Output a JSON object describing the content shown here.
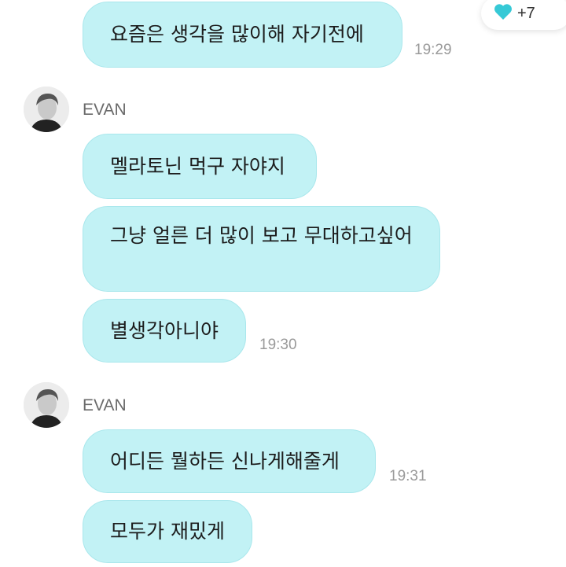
{
  "reaction": {
    "icon": "heart-icon",
    "count": "+7",
    "color": "#36c9d6"
  },
  "messages": [
    {
      "text": "요즘은 생각을 많이해 자기전에",
      "time": "19:29"
    },
    {
      "sender": "EVAN",
      "text": "멜라토닌 먹구 자야지"
    },
    {
      "text": "그냥 얼른 더 많이 보고 무대하고싶어"
    },
    {
      "text": "별생각아니야",
      "time": "19:30"
    },
    {
      "sender": "EVAN",
      "text": "어디든 뭘하든 신나게해줄게",
      "time": "19:31"
    },
    {
      "text": "모두가 재밌게"
    }
  ],
  "colors": {
    "bubble": "#c2f2f5",
    "bubble_border": "#a9e7ec",
    "time": "#9a9a9a"
  }
}
